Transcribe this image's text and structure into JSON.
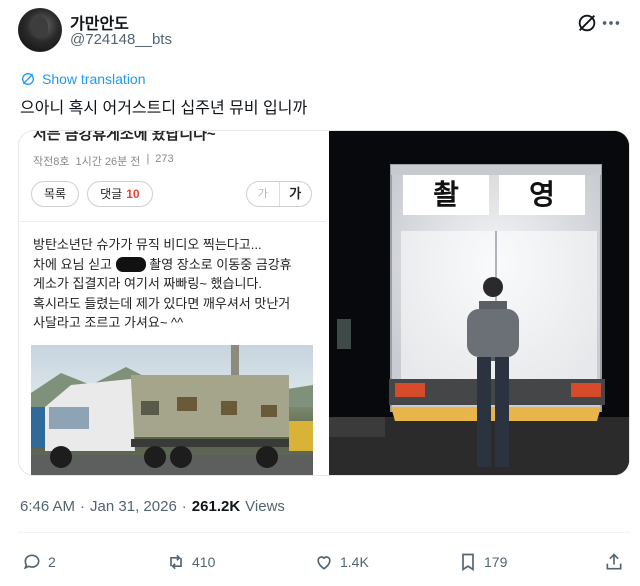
{
  "author": {
    "display_name": "가만안도",
    "handle": "@724148__bts"
  },
  "translate_label": "Show translation",
  "tweet_text": "으아니 혹시 어거스트디 십주년 뮤비 입니까",
  "screenshot_post": {
    "cut_title": "저는 금강휴게소에 왔답니다~",
    "category": "작전8호",
    "time_ago": "1시간 26분 전",
    "views": "273",
    "list_button": "목록",
    "comment_label": "댓글",
    "comment_count": "10",
    "font_small": "가",
    "font_big": "가",
    "lines": [
      "방탄소년단 슈가가 뮤직 비디오 찍는다고...",
      "차에 요님 싣고",
      "촬영 장소로 이동중 금강휴",
      "게소가 집결지라 여기서 짜빠링~ 했습니다.",
      "혹시라도 들렸는데 제가 있다면 깨우셔서 맛난거",
      "사달라고 조르고 가셔요~ ^^"
    ]
  },
  "truck_sign": {
    "left": "촬",
    "right": "영"
  },
  "timestamp": {
    "time": "6:46 AM",
    "dot": "·",
    "date": "Jan 31, 2026",
    "views_count": "261.2K",
    "views_label": "Views"
  },
  "actions": {
    "replies": "2",
    "reposts": "410",
    "likes": "1.4K",
    "bookmarks": "179"
  },
  "colors": {
    "link_blue": "#1d9bf0",
    "secondary_text": "#536471",
    "comment_count_red": "#e6453a"
  }
}
